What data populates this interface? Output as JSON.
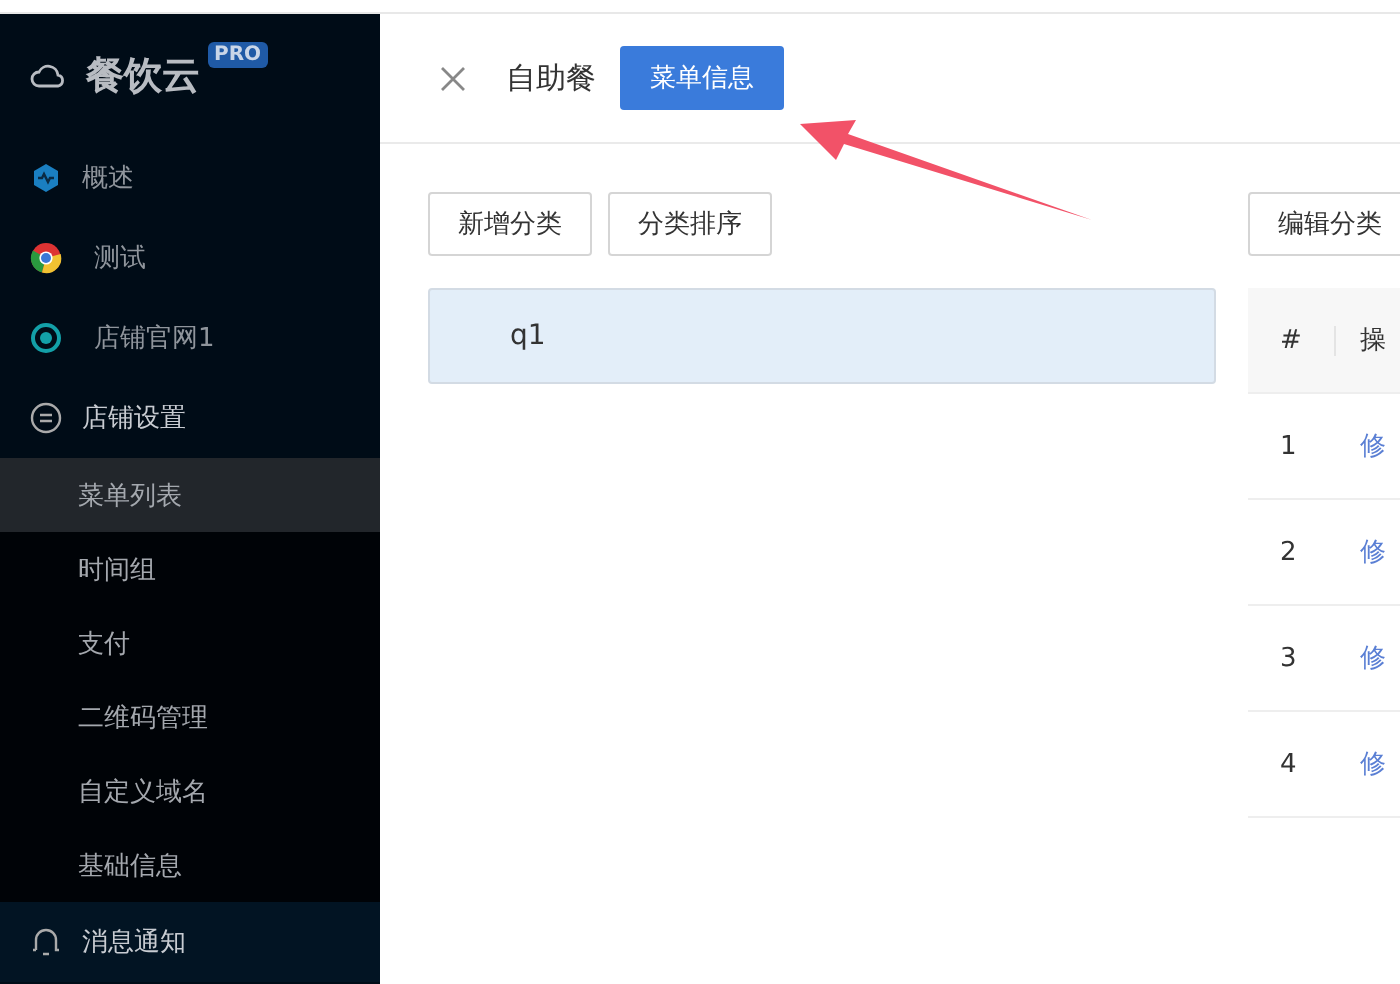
{
  "sidebar": {
    "brand": "餐饮云",
    "badge": "PRO",
    "items": [
      {
        "label": "概述",
        "kind": "app"
      },
      {
        "label": "测试",
        "kind": "app"
      },
      {
        "label": "店铺官网1",
        "kind": "app"
      },
      {
        "label": "店铺设置",
        "kind": "group",
        "expanded": true,
        "children": [
          {
            "label": "菜单列表",
            "selected": true
          },
          {
            "label": "时间组",
            "selected": false
          },
          {
            "label": "支付",
            "selected": false
          },
          {
            "label": "二维码管理",
            "selected": false
          },
          {
            "label": "自定义域名",
            "selected": false
          },
          {
            "label": "基础信息",
            "selected": false
          }
        ]
      },
      {
        "label": "消息通知",
        "kind": "group",
        "expanded": false
      }
    ]
  },
  "header": {
    "title": "自助餐",
    "tab": "菜单信息"
  },
  "category_buttons": [
    "新增分类",
    "分类排序"
  ],
  "categories": [
    {
      "label": "q1",
      "selected": true
    }
  ],
  "edit_button": "编辑分类",
  "table": {
    "columns": [
      "#",
      "操"
    ],
    "rows": [
      {
        "index": "1",
        "action": "修"
      },
      {
        "index": "2",
        "action": "修"
      },
      {
        "index": "3",
        "action": "修"
      },
      {
        "index": "4",
        "action": "修"
      }
    ]
  }
}
